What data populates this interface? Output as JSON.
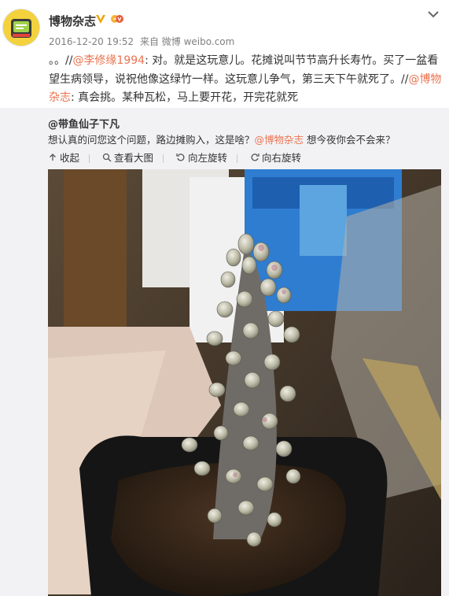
{
  "post": {
    "author": "博物杂志",
    "timestamp": "2016-12-20 19:52",
    "source": "来自 微博 weibo.com",
    "content": {
      "prefix": "。。//",
      "mention1": "@李修缘1994",
      "text1": ": 对。就是这玩意儿。花摊说叫节节高升长寿竹。买了一盆看望生病领导，说祝他像这绿竹一样。这玩意儿争气，第三天下午就死了。//",
      "mention2": "@博物杂志",
      "text2": ": 真会挑。某种瓦松，马上要开花，开完花就死"
    }
  },
  "quote": {
    "author": "@带鱼仙子下凡",
    "text_before": "想认真的问您这个问题，路边摊购入，这是啥？",
    "mention": "@博物杂志",
    "text_after": " 想今夜你会不会来？"
  },
  "toolbar": {
    "collapse": "收起",
    "view_large": "查看大图",
    "rotate_left": "向左旋转",
    "rotate_right": "向右旋转"
  },
  "icons": {
    "avatar": "magazine-logo-avatar",
    "verified": "verified-v-icon",
    "badge": "member-badge-icon",
    "menu": "chevron-down-icon"
  },
  "colors": {
    "link": "#eb7350",
    "verified": "#f0a30a",
    "quote_bg": "#f2f2f5",
    "meta_text": "#808080"
  }
}
